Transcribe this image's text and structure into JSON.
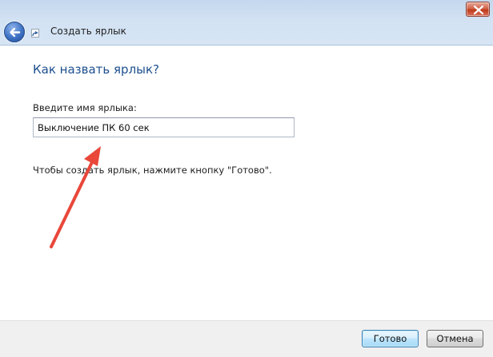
{
  "window": {
    "title": "Создать ярлык",
    "icons": {
      "back": "back-arrow-icon",
      "app": "shortcut-icon",
      "close": "close-icon"
    }
  },
  "main": {
    "heading": "Как назвать ярлык?",
    "name_label": "Введите имя ярлыка:",
    "name_value": "Выключение ПК 60 сек",
    "hint": "Чтобы создать ярлык, нажмите кнопку \"Готово\"."
  },
  "annotation": {
    "color": "#e8473a"
  },
  "footer": {
    "finish_label": "Готово",
    "cancel_label": "Отмена"
  },
  "colors": {
    "heading": "#1d4f8f",
    "titlebar": "#d3e2f3",
    "close": "#c0391b"
  }
}
